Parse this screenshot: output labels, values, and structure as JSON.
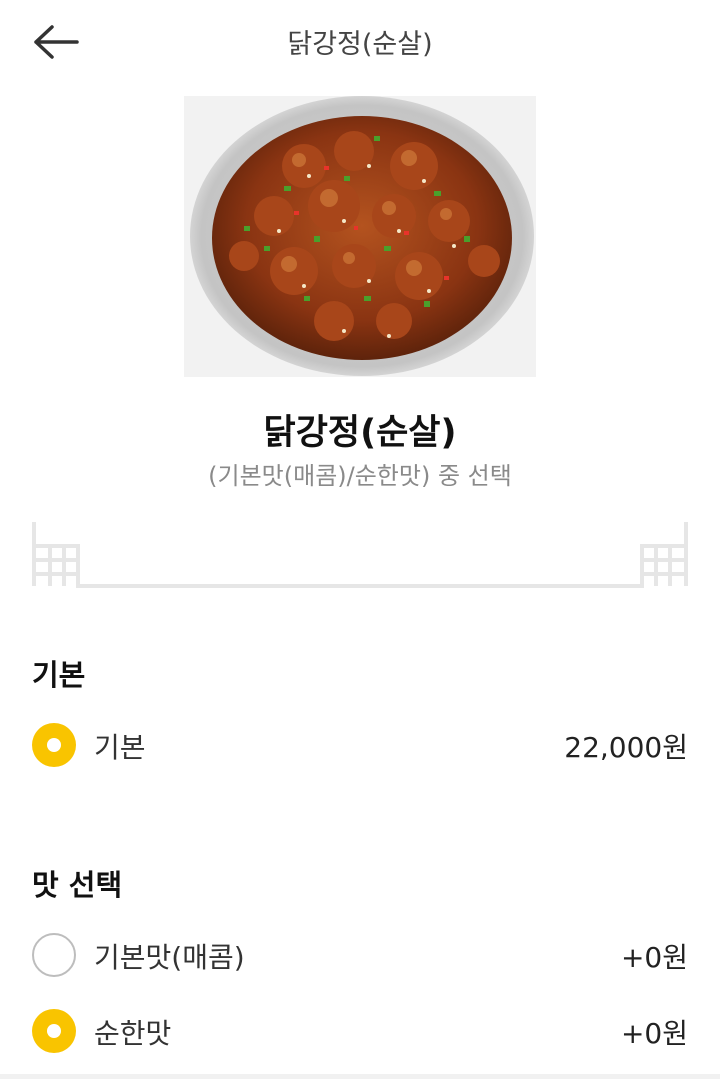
{
  "header": {
    "title": "닭강정(순살)"
  },
  "product": {
    "name": "닭강정(순살)",
    "description": "(기본맛(매콤)/순한맛) 중 선택"
  },
  "sections": [
    {
      "title": "기본",
      "options": [
        {
          "label": "기본",
          "price": "22,000원",
          "selected": true
        }
      ]
    },
    {
      "title": "맛 선택",
      "options": [
        {
          "label": "기본맛(매콤)",
          "price": "+0원",
          "selected": false
        },
        {
          "label": "순한맛",
          "price": "+0원",
          "selected": true
        }
      ]
    }
  ],
  "colors": {
    "accent": "#f9c400",
    "radio_off_border": "#bdbdbd",
    "divider_pattern": "#e6e6e6"
  }
}
